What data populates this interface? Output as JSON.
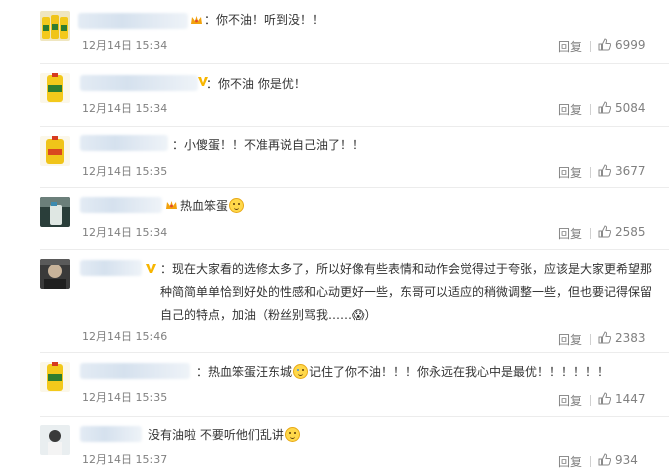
{
  "comments": [
    {
      "text": "：你不油！听到没！！",
      "time": "12月14日 15:34",
      "reply": "回复",
      "likes": "6999"
    },
    {
      "text": "：你不油 你是优！",
      "time": "12月14日 15:34",
      "reply": "回复",
      "likes": "5084"
    },
    {
      "text": "：小傻蛋！！不准再说自己油了！！",
      "time": "12月14日 15:35",
      "reply": "回复",
      "likes": "3677"
    },
    {
      "text": "热血笨蛋",
      "time": "12月14日 15:34",
      "reply": "回复",
      "likes": "2585"
    },
    {
      "text": "：现在大家看的选修太多了，所以好像有些表情和动作会觉得过于夸张，应该是大家更希望那种简简单单恰到好处的性感和心动更好一些，东哥可以适应的稍微调整一些，但也要记得保留自己的特点，加油（粉丝别骂我……😱）",
      "time": "12月14日 15:46",
      "reply": "回复",
      "likes": "2383"
    },
    {
      "text_a": "：热血笨蛋汪东城",
      "text_b": "记住了你不油！！！你永远在我心中是最优！！！！！！",
      "time": "12月14日 15:35",
      "reply": "回复",
      "likes": "1447"
    },
    {
      "text": "没有油啦 不要听他们乱讲",
      "time": "12月14日 15:37",
      "reply": "回复",
      "likes": "934"
    }
  ],
  "colors": {
    "text": "#333333",
    "meta": "#808080",
    "divider": "#ececec",
    "crown": "#f2a20c",
    "vip": "#f7b500"
  },
  "icons": {
    "like": "thumbs-up-icon",
    "crown": "crown-icon",
    "vip": "vip-v-icon",
    "emoji": "emoji-face-icon"
  }
}
